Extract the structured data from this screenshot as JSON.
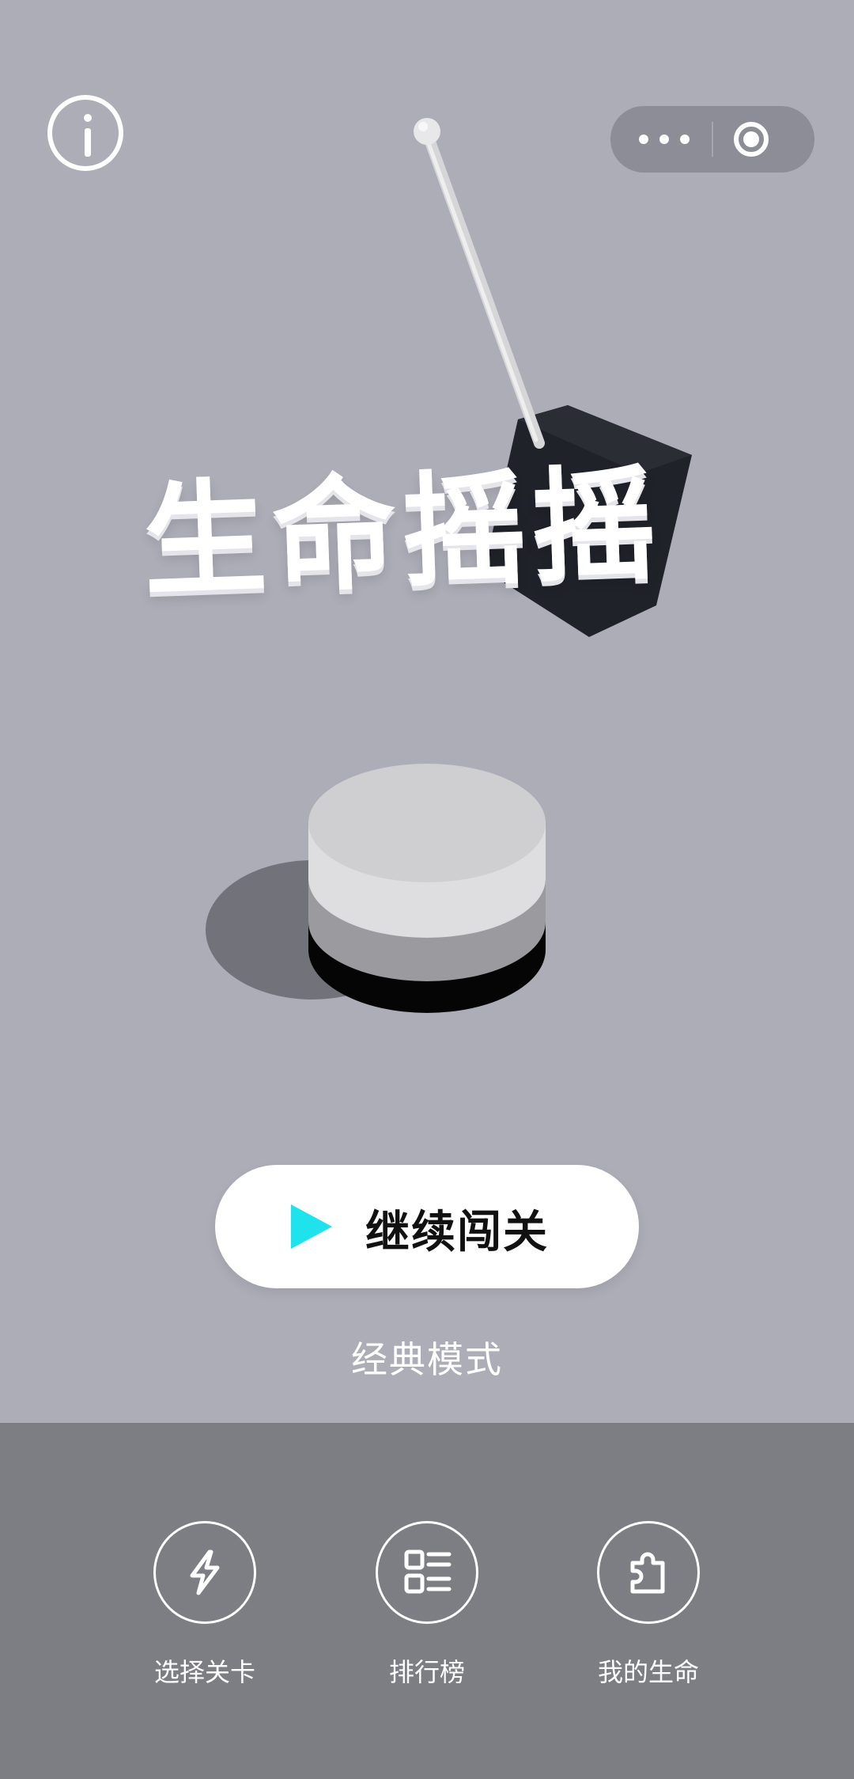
{
  "title": "生命摇摇",
  "continue_button": {
    "label": "继续闯关",
    "icon": "play-icon",
    "icon_color": "#1ee3ec"
  },
  "mode_label": "经典模式",
  "top_bar": {
    "info_icon": "info-icon",
    "more_icon": "more-dots-icon",
    "close_icon": "target-close-icon"
  },
  "bottom_nav": [
    {
      "label": "选择关卡",
      "icon": "lightning-icon"
    },
    {
      "label": "排行榜",
      "icon": "leaderboard-list-icon"
    },
    {
      "label": "我的生命",
      "icon": "puzzle-piece-icon"
    }
  ],
  "colors": {
    "background": "#adadb8",
    "bottom_panel": "#7d7d84",
    "button_bg": "#ffffff",
    "accent": "#1ee3ec"
  }
}
